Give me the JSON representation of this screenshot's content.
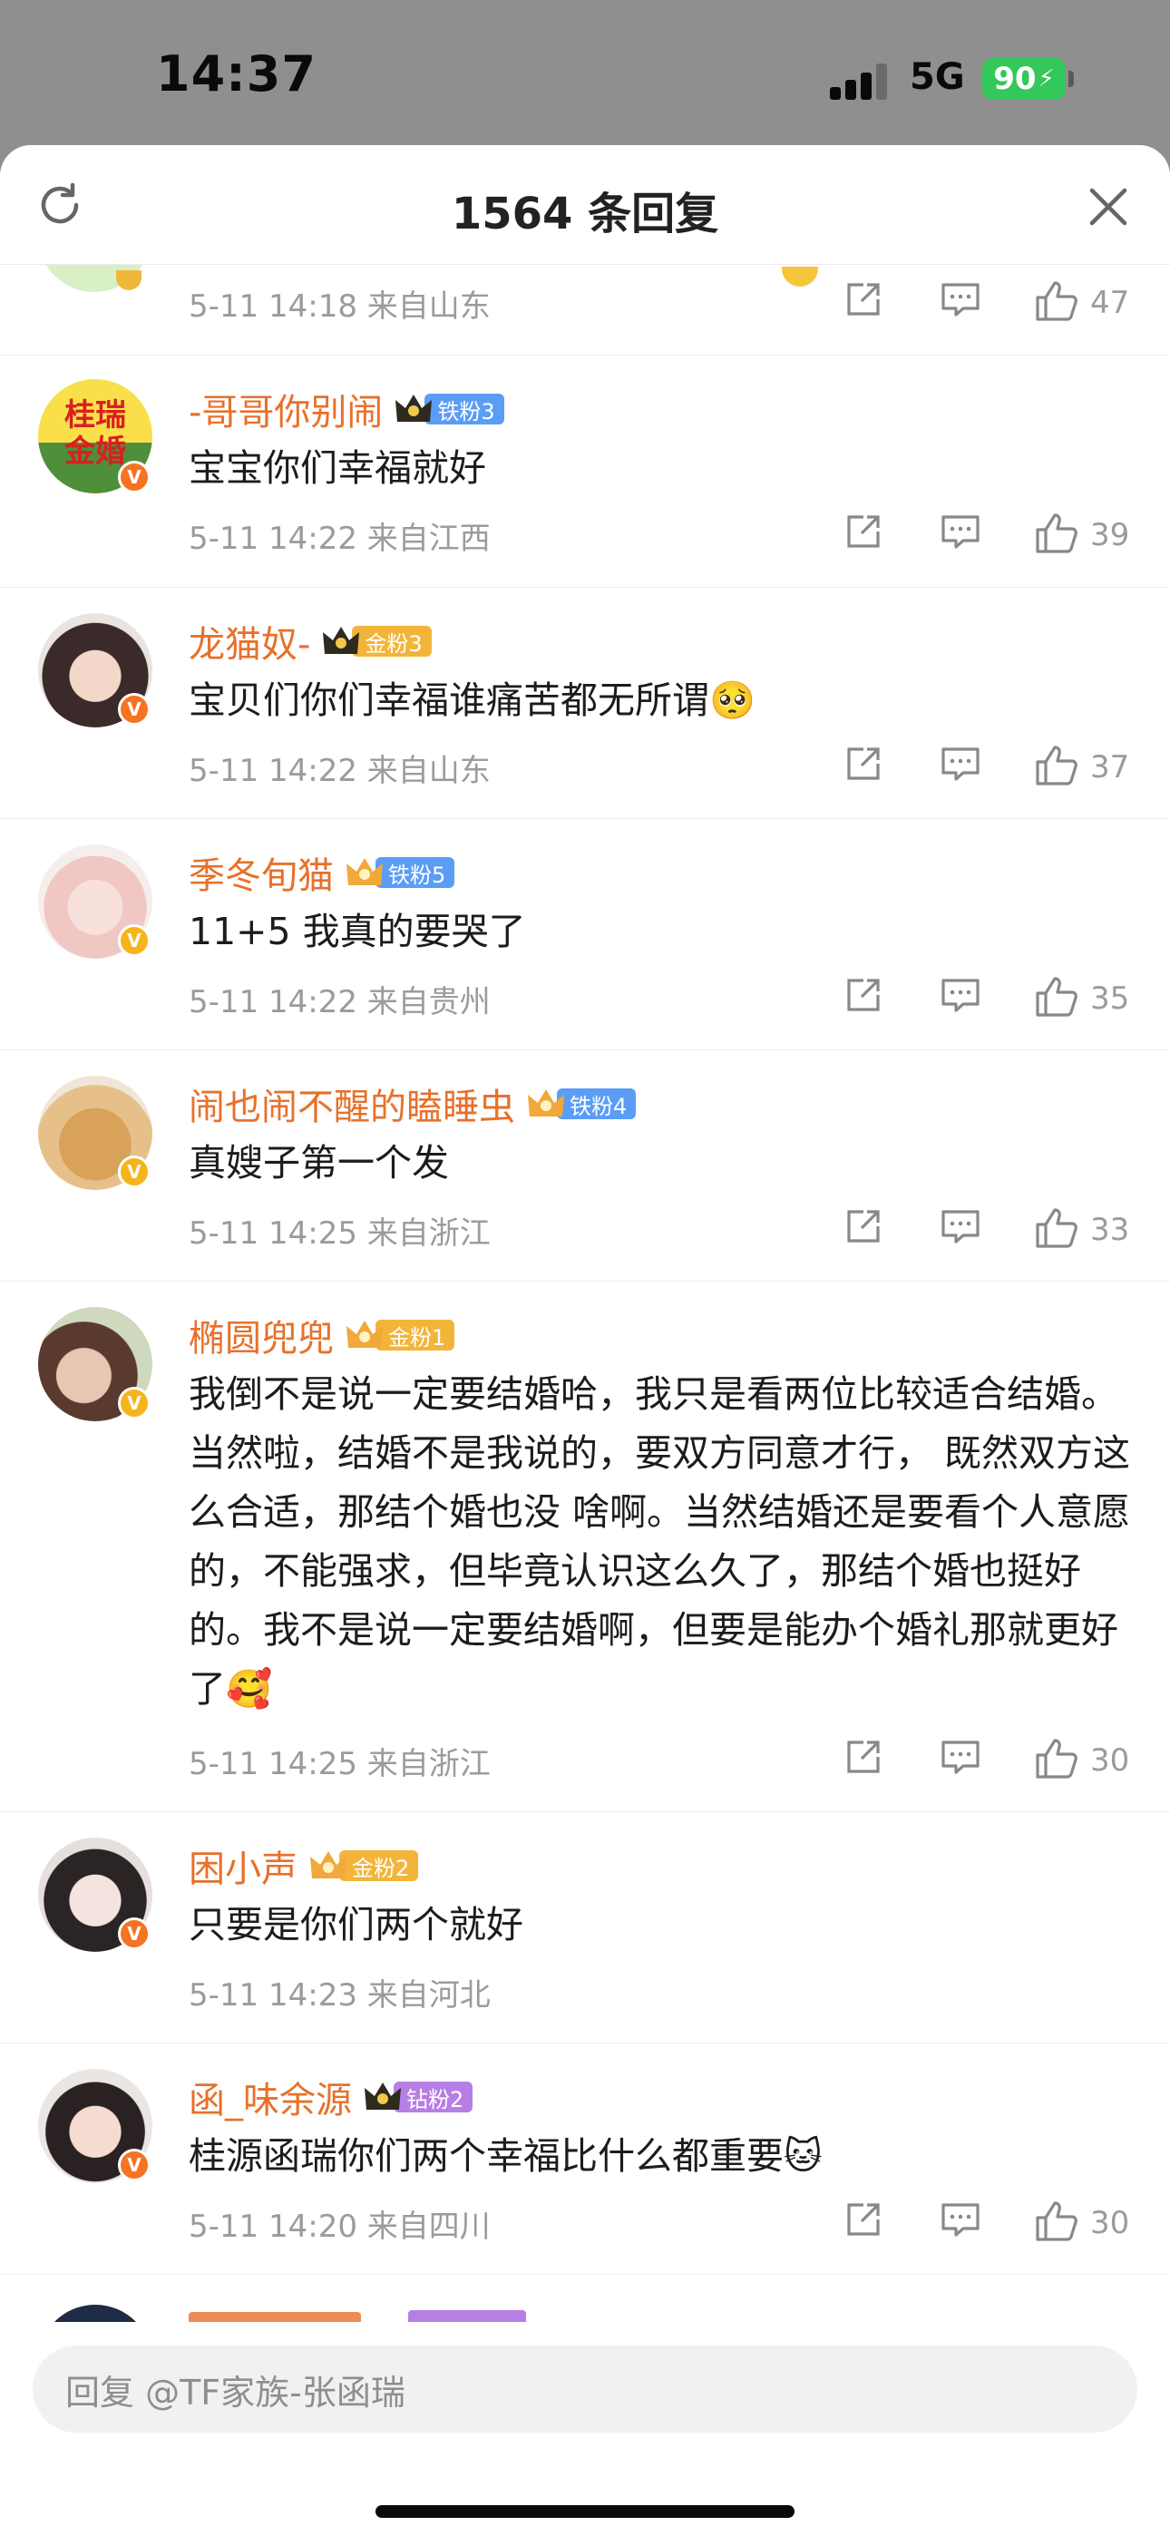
{
  "status_bar": {
    "time": "14:37",
    "network": "5G",
    "battery": "90"
  },
  "header": {
    "title": "1564 条回复"
  },
  "top_partial": {
    "meta": "5-11 14:18  来自山东",
    "likes": "47"
  },
  "comments": [
    {
      "name": "-哥哥你别闹",
      "fan": "铁粉3",
      "fan_color": "#5b9df5",
      "text": "宝宝你们幸福就好",
      "meta": "5-11 14:22  来自江西",
      "likes": "39",
      "avatar_text": "桂瑞\n金婚"
    },
    {
      "name": "龙猫奴-",
      "fan": "金粉3",
      "fan_color": "#f2b53a",
      "text": "宝贝们你们幸福谁痛苦都无所谓🥺",
      "meta": "5-11 14:22  来自山东",
      "likes": "37"
    },
    {
      "name": "季冬旬猫",
      "fan": "铁粉5",
      "fan_color": "#5b9df5",
      "text": "11+5 我真的要哭了",
      "meta": "5-11 14:22  来自贵州",
      "likes": "35"
    },
    {
      "name": "闹也闹不醒的瞌睡虫",
      "fan": "铁粉4",
      "fan_color": "#5b9df5",
      "text": "真嫂子第一个发",
      "meta": "5-11 14:25  来自浙江",
      "likes": "33"
    },
    {
      "name": "椭圆兜兜",
      "fan": "金粉1",
      "fan_color": "#f2b53a",
      "text": "我倒不是说一定要结婚哈，我只是看两位比较适合结婚。当然啦，结婚不是我说的，要双方同意才行， 既然双方这么合适，那结个婚也没 啥啊。当然结婚还是要看个人意愿的，不能强求，但毕竟认识这么久了，那结个婚也挺好的。我不是说一定要结婚啊，但要是能办个婚礼那就更好了🥰",
      "meta": "5-11 14:25  来自浙江",
      "likes": "30"
    },
    {
      "name": "困小声",
      "fan": "金粉2",
      "fan_color": "#f2b53a",
      "text": "只要是你们两个就好",
      "meta": "5-11 14:23  来自河北",
      "likes": ""
    },
    {
      "name": "函_味余源",
      "fan": "钻粉2",
      "fan_color": "#b77ee6",
      "text": "桂源函瑞你们两个幸福比什么都重要🐱",
      "meta": "5-11 14:20  来自四川",
      "likes": "30"
    }
  ],
  "reply_input": {
    "placeholder": "回复 @TF家族-张函瑞"
  },
  "colors": {
    "accent_name": "#e8702a",
    "meta": "#9b9b9b",
    "battery": "#34c759"
  }
}
